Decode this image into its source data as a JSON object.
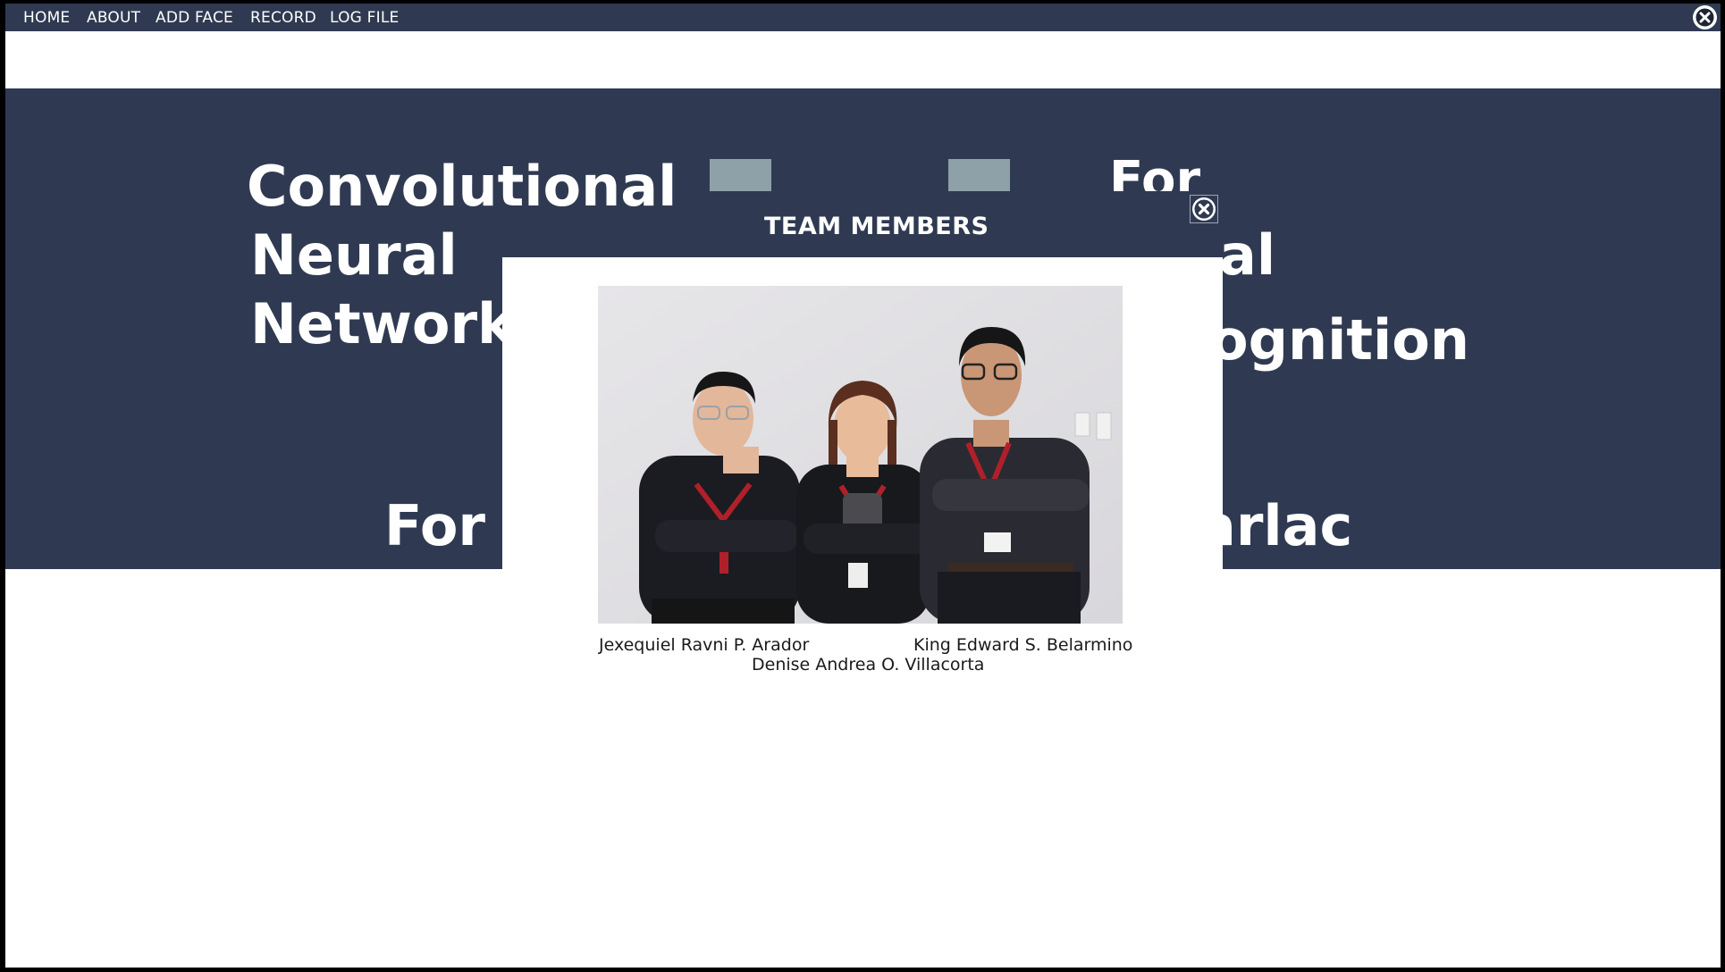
{
  "menu": {
    "items": [
      "HOME",
      "ABOUT",
      "ADD FACE",
      "RECORD",
      "LOG FILE"
    ],
    "close_icon": "close-circle-icon"
  },
  "hero": {
    "line_convolutional": "Convolutional",
    "line_neural": "Neural",
    "line_network": "Network",
    "line_for": "For",
    "line_al": "al",
    "line_ognition": "ognition",
    "line_for_a": "For A",
    "line_arlac": "arlac"
  },
  "modal": {
    "title": "TEAM MEMBERS",
    "close_icon": "close-circle-icon",
    "photo_alt": "Team members photo",
    "members": {
      "left": "Jexequiel Ravni P. Arador",
      "right": "King Edward S. Belarmino",
      "center": "Denise Andrea O. Villacorta"
    }
  },
  "colors": {
    "navy": "#2f3a52",
    "accent_gray": "#8fa1a8",
    "white": "#ffffff"
  }
}
